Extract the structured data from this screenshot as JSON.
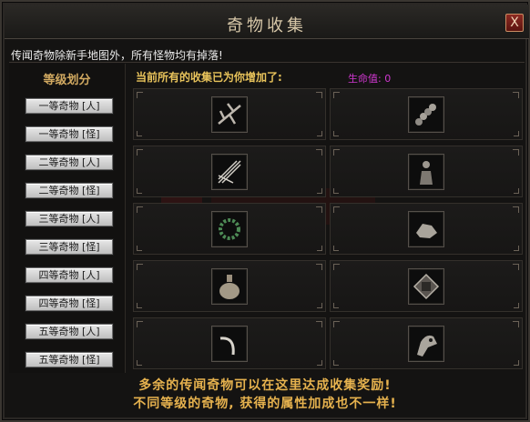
{
  "window": {
    "title": "奇物收集",
    "close_glyph": "X",
    "notice": "传闻奇物除新手地图外，所有怪物均有掉落!"
  },
  "sidebar": {
    "heading": "等级划分",
    "tiers": [
      {
        "label": "一等奇物 [人]"
      },
      {
        "label": "一等奇物 [怪]"
      },
      {
        "label": "二等奇物 [人]"
      },
      {
        "label": "二等奇物 [怪]"
      },
      {
        "label": "三等奇物 [人]"
      },
      {
        "label": "三等奇物 [怪]"
      },
      {
        "label": "四等奇物 [人]"
      },
      {
        "label": "四等奇物 [怪]"
      },
      {
        "label": "五等奇物 [人]"
      },
      {
        "label": "五等奇物 [怪]"
      }
    ]
  },
  "main": {
    "bonus_text": "当前所有的收集已为你增加了:",
    "life_text": "生命值: 0"
  },
  "grid": {
    "slots": [
      {
        "icon": "broken-branch-icon"
      },
      {
        "icon": "rope-coil-icon"
      },
      {
        "icon": "bundle-sticks-icon"
      },
      {
        "icon": "figure-statue-icon"
      },
      {
        "icon": "bead-bracelet-icon"
      },
      {
        "icon": "ore-chunk-icon"
      },
      {
        "icon": "potion-flask-icon"
      },
      {
        "icon": "rune-plate-icon"
      },
      {
        "icon": "curved-horn-icon"
      },
      {
        "icon": "beast-skull-icon"
      }
    ]
  },
  "footer": {
    "line1": "多余的传闻奇物可以在这里达成收集奖励!",
    "line2": "不同等级的奇物, 获得的属性加成也不一样!"
  },
  "colors": {
    "accent_gold": "#e6b24e",
    "life_purple": "#d037d0",
    "close_red": "#8c2a22"
  }
}
